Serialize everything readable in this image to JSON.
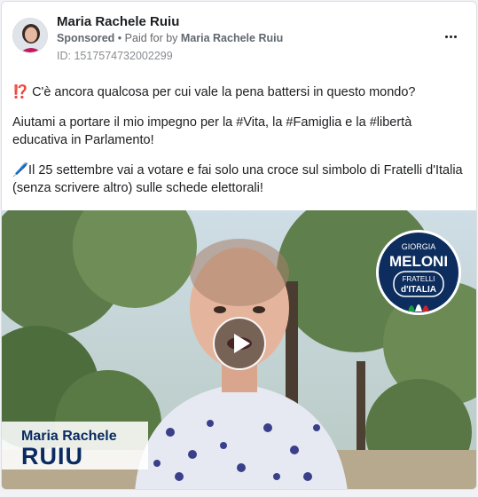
{
  "post": {
    "page_name": "Maria Rachele Ruiu",
    "sponsored_label": "Sponsored",
    "separator": "•",
    "paid_for_text": "Paid for by",
    "paid_by_name": "Maria Rachele Ruiu",
    "ad_id": "ID: 1517574732002299",
    "more_icon": "more-horizontal-icon"
  },
  "body": {
    "paragraph_1": "⁉️ C'è ancora qualcosa per cui vale la pena battersi in questo mondo?",
    "paragraph_2": "Aiutami a portare il mio impegno per la #Vita, la #Famiglia e la #libertà educativa in Parlamento!",
    "paragraph_3": "🖊️Il 25 settembre vai a votare e fai solo una croce sul simbolo di Fratelli d'Italia (senza scrivere altro) sulle schede elettorali!"
  },
  "media": {
    "type": "video",
    "play_icon": "play-icon",
    "caption_first": "Maria Rachele",
    "caption_last": "RUIU",
    "logo": {
      "top": "GIORGIA",
      "main": "MELONI",
      "line1": "FRATELLI",
      "line2": "d'ITALIA"
    }
  },
  "colors": {
    "caption_blue": "#0a2a62",
    "logo_blue": "#0c2d5e",
    "flame_green": "#1c9a3f",
    "flame_red": "#d0202b"
  }
}
